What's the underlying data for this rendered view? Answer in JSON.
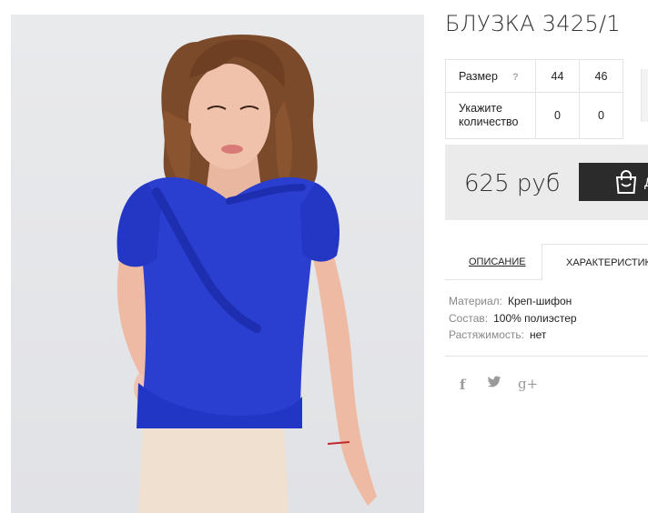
{
  "product": {
    "title": "БЛУЗКА 3425/1"
  },
  "size_table": {
    "size_label": "Размер",
    "help": "?",
    "sizes": [
      "44",
      "46"
    ],
    "qty_label_line1": "Укажите",
    "qty_label_line2": "количество",
    "quantities": [
      "0",
      "0"
    ]
  },
  "price": {
    "amount": "625 руб",
    "cart_button_text": "Д"
  },
  "tabs": {
    "description": "ОПИСАНИЕ",
    "characteristics": "ХАРАКТЕРИСТИК"
  },
  "specs": [
    {
      "key": "Материал:",
      "value": "Креп-шифон"
    },
    {
      "key": "Состав:",
      "value": "100% полиэстер"
    },
    {
      "key": "Растяжимость:",
      "value": "нет"
    }
  ],
  "social": {
    "facebook": "f",
    "gplus": "g+"
  },
  "colors": {
    "blouse": "#2a3fd0",
    "button": "#2b2b2b",
    "price_bg": "#ebebeb"
  },
  "icons": {
    "help": "question-icon",
    "cart": "shopping-bag-icon",
    "facebook": "facebook-icon",
    "twitter": "twitter-icon",
    "gplus": "google-plus-icon"
  }
}
